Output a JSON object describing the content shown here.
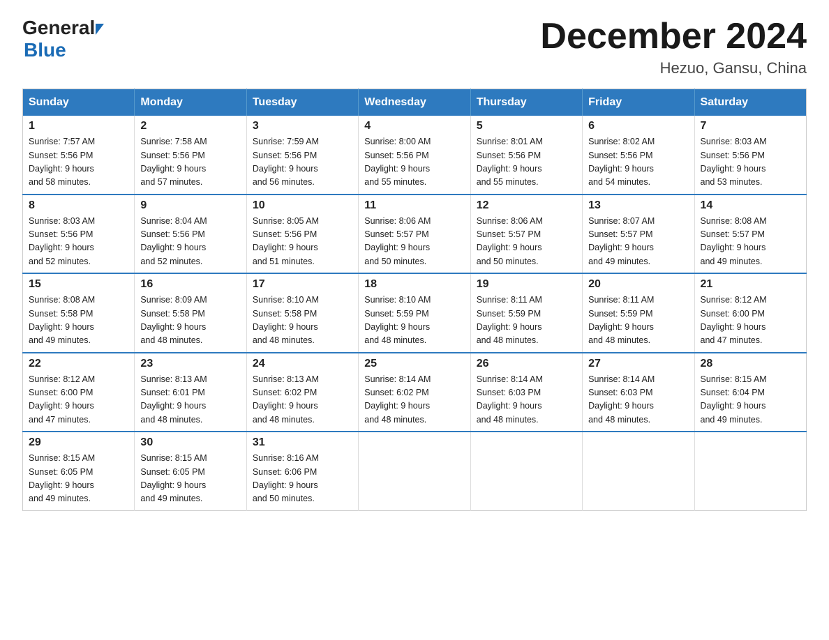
{
  "header": {
    "logo_general": "General",
    "logo_blue": "Blue",
    "month_title": "December 2024",
    "location": "Hezuo, Gansu, China"
  },
  "days_of_week": [
    "Sunday",
    "Monday",
    "Tuesday",
    "Wednesday",
    "Thursday",
    "Friday",
    "Saturday"
  ],
  "weeks": [
    [
      {
        "day": "1",
        "sunrise": "7:57 AM",
        "sunset": "5:56 PM",
        "daylight": "9 hours and 58 minutes."
      },
      {
        "day": "2",
        "sunrise": "7:58 AM",
        "sunset": "5:56 PM",
        "daylight": "9 hours and 57 minutes."
      },
      {
        "day": "3",
        "sunrise": "7:59 AM",
        "sunset": "5:56 PM",
        "daylight": "9 hours and 56 minutes."
      },
      {
        "day": "4",
        "sunrise": "8:00 AM",
        "sunset": "5:56 PM",
        "daylight": "9 hours and 55 minutes."
      },
      {
        "day": "5",
        "sunrise": "8:01 AM",
        "sunset": "5:56 PM",
        "daylight": "9 hours and 55 minutes."
      },
      {
        "day": "6",
        "sunrise": "8:02 AM",
        "sunset": "5:56 PM",
        "daylight": "9 hours and 54 minutes."
      },
      {
        "day": "7",
        "sunrise": "8:03 AM",
        "sunset": "5:56 PM",
        "daylight": "9 hours and 53 minutes."
      }
    ],
    [
      {
        "day": "8",
        "sunrise": "8:03 AM",
        "sunset": "5:56 PM",
        "daylight": "9 hours and 52 minutes."
      },
      {
        "day": "9",
        "sunrise": "8:04 AM",
        "sunset": "5:56 PM",
        "daylight": "9 hours and 52 minutes."
      },
      {
        "day": "10",
        "sunrise": "8:05 AM",
        "sunset": "5:56 PM",
        "daylight": "9 hours and 51 minutes."
      },
      {
        "day": "11",
        "sunrise": "8:06 AM",
        "sunset": "5:57 PM",
        "daylight": "9 hours and 50 minutes."
      },
      {
        "day": "12",
        "sunrise": "8:06 AM",
        "sunset": "5:57 PM",
        "daylight": "9 hours and 50 minutes."
      },
      {
        "day": "13",
        "sunrise": "8:07 AM",
        "sunset": "5:57 PM",
        "daylight": "9 hours and 49 minutes."
      },
      {
        "day": "14",
        "sunrise": "8:08 AM",
        "sunset": "5:57 PM",
        "daylight": "9 hours and 49 minutes."
      }
    ],
    [
      {
        "day": "15",
        "sunrise": "8:08 AM",
        "sunset": "5:58 PM",
        "daylight": "9 hours and 49 minutes."
      },
      {
        "day": "16",
        "sunrise": "8:09 AM",
        "sunset": "5:58 PM",
        "daylight": "9 hours and 48 minutes."
      },
      {
        "day": "17",
        "sunrise": "8:10 AM",
        "sunset": "5:58 PM",
        "daylight": "9 hours and 48 minutes."
      },
      {
        "day": "18",
        "sunrise": "8:10 AM",
        "sunset": "5:59 PM",
        "daylight": "9 hours and 48 minutes."
      },
      {
        "day": "19",
        "sunrise": "8:11 AM",
        "sunset": "5:59 PM",
        "daylight": "9 hours and 48 minutes."
      },
      {
        "day": "20",
        "sunrise": "8:11 AM",
        "sunset": "5:59 PM",
        "daylight": "9 hours and 48 minutes."
      },
      {
        "day": "21",
        "sunrise": "8:12 AM",
        "sunset": "6:00 PM",
        "daylight": "9 hours and 47 minutes."
      }
    ],
    [
      {
        "day": "22",
        "sunrise": "8:12 AM",
        "sunset": "6:00 PM",
        "daylight": "9 hours and 47 minutes."
      },
      {
        "day": "23",
        "sunrise": "8:13 AM",
        "sunset": "6:01 PM",
        "daylight": "9 hours and 48 minutes."
      },
      {
        "day": "24",
        "sunrise": "8:13 AM",
        "sunset": "6:02 PM",
        "daylight": "9 hours and 48 minutes."
      },
      {
        "day": "25",
        "sunrise": "8:14 AM",
        "sunset": "6:02 PM",
        "daylight": "9 hours and 48 minutes."
      },
      {
        "day": "26",
        "sunrise": "8:14 AM",
        "sunset": "6:03 PM",
        "daylight": "9 hours and 48 minutes."
      },
      {
        "day": "27",
        "sunrise": "8:14 AM",
        "sunset": "6:03 PM",
        "daylight": "9 hours and 48 minutes."
      },
      {
        "day": "28",
        "sunrise": "8:15 AM",
        "sunset": "6:04 PM",
        "daylight": "9 hours and 49 minutes."
      }
    ],
    [
      {
        "day": "29",
        "sunrise": "8:15 AM",
        "sunset": "6:05 PM",
        "daylight": "9 hours and 49 minutes."
      },
      {
        "day": "30",
        "sunrise": "8:15 AM",
        "sunset": "6:05 PM",
        "daylight": "9 hours and 49 minutes."
      },
      {
        "day": "31",
        "sunrise": "8:16 AM",
        "sunset": "6:06 PM",
        "daylight": "9 hours and 50 minutes."
      },
      null,
      null,
      null,
      null
    ]
  ],
  "labels": {
    "sunrise": "Sunrise:",
    "sunset": "Sunset:",
    "daylight": "Daylight:"
  }
}
